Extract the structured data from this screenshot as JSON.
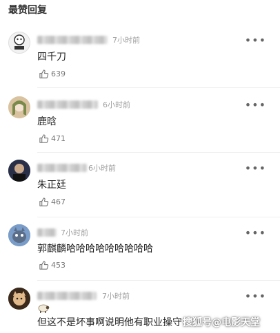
{
  "header": {
    "title": "最赞回复"
  },
  "comments": [
    {
      "time": "7小时前",
      "text": "四千刀",
      "likes": "639",
      "more": "•••"
    },
    {
      "time": "6小时前",
      "text": "鹿晗",
      "likes": "471",
      "more": "•••"
    },
    {
      "time": "6小时前",
      "text": "朱正廷",
      "likes": "467",
      "more": "•••"
    },
    {
      "time": "7小时前",
      "text": "郭麒麟哈哈哈哈哈哈哈哈哈",
      "likes": "453",
      "more": "•••"
    },
    {
      "time": "7小时前",
      "text": "但这不是坏事啊说明他有职业操守",
      "more": "•••"
    }
  ],
  "watermark": {
    "text": "搜狐号@电影天堂"
  },
  "colors": {
    "muted": "#a0a0a0",
    "text": "#222222",
    "divider": "#eeeeee"
  }
}
